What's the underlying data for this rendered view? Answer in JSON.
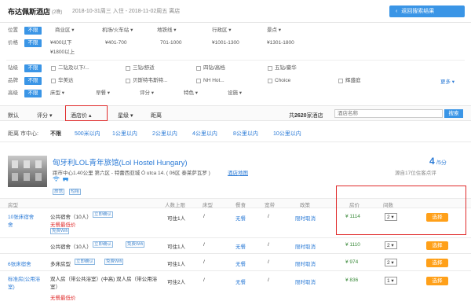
{
  "header": {
    "hotel": "布达佩斯酒店",
    "nights": "(2晚)",
    "dates": "2018-10-31周三 入住 - 2018-11-02周五 离店",
    "back_button": "返回搜索结果"
  },
  "filters": {
    "location_label": "位置",
    "location_opts": [
      "不限",
      "商业区",
      "机场/火车站",
      "地铁线",
      "行政区",
      "景点"
    ],
    "price_label": "价格",
    "price_opts": [
      "不限",
      "¥400以下",
      "¥401-700",
      "701-1000",
      "¥1001-1300",
      "¥1301-1800",
      "¥1800以上"
    ],
    "star_label": "钻级",
    "star_opts": [
      "不限",
      "二钻及以下/...",
      "三钻/舒适",
      "四钻/高档",
      "五钻/豪华"
    ],
    "brand_label": "品牌",
    "brand_opts": [
      "不限",
      "华美达",
      "贝斯特韦斯特...",
      "NH Hot...",
      "Choice",
      "辉盛庭"
    ],
    "more": "更多",
    "adv_label": "高级",
    "adv_opts": [
      "不限",
      "床型",
      "早餐",
      "评分",
      "特色",
      "设施"
    ]
  },
  "sortbar": {
    "default": "默认",
    "score": "评分",
    "price": "酒店价",
    "star": "星级",
    "distance": "距离",
    "count_prefix": "共",
    "count": "2620",
    "count_suffix": "家酒店",
    "search_placeholder": "酒店名称",
    "search_button": "搜索"
  },
  "distbar": {
    "label": "距离 市中心:",
    "opts": [
      "不限",
      "500米以内",
      "1公里以内",
      "2公里以内",
      "4公里以内",
      "8公里以内",
      "10公里以内"
    ]
  },
  "hotel": {
    "name": "匈牙利LOL青年旅馆(Lol Hostel Hungary)",
    "address": "距市中心1.40公里  第六区 - 特蕾西亚城 Ó utca 14. ( 06区 泰莱萨瓦罗 )",
    "map_link": "酒店地图",
    "tag1": "旅馆",
    "tag2": "短租",
    "score": "4",
    "score_suffix": "/5分",
    "reviews": "源自17位住客点评"
  },
  "table": {
    "headers": [
      "房型",
      "人数上限",
      "床型",
      "餐食",
      "宽带",
      "政策",
      "房价",
      "间数"
    ],
    "rooms": [
      {
        "type": "10张床宿舍",
        "name": "公共宿舍（10人）",
        "confirm": "立即确认",
        "promo": "无餐最低价",
        "wifi": "免费Wifi",
        "capacity": "可住1人",
        "bed": "/",
        "meal": "无餐",
        "net": "/",
        "policy": "限时取消",
        "price": "¥ 1114",
        "qty": "2",
        "book": "选择"
      },
      {
        "type": "",
        "name": "公共宿舍（10人）",
        "confirm": "立即确认",
        "promo": "",
        "wifi": "免费Wifi",
        "capacity": "可住1人",
        "bed": "/",
        "meal": "无餐",
        "net": "/",
        "policy": "限时取消",
        "price": "¥ 1110",
        "qty": "2",
        "book": "选择"
      },
      {
        "type": "6张床宿舍",
        "name": "多床房型",
        "confirm": "立即确认",
        "promo": "",
        "wifi": "免费Wifi",
        "capacity": "可住1人",
        "bed": "/",
        "meal": "无餐",
        "net": "/",
        "policy": "限时取消",
        "price": "¥ 974",
        "qty": "2",
        "book": "选择"
      },
      {
        "type": "标准房(公用浴室)",
        "name": "双人房（带公共浴室）(中高) 双人房（带公用浴室）",
        "confirm": "",
        "promo": "无餐最低价",
        "wifi": "",
        "capacity": "可住2人",
        "bed": "/",
        "meal": "无餐",
        "net": "/",
        "policy": "限时取消",
        "price": "¥ 836",
        "qty": "1",
        "book": "选择"
      }
    ]
  },
  "colors": {
    "accent": "#3a95e6",
    "link": "#2a7ad6",
    "orange": "#ffa019",
    "highlight": "#e02b2b",
    "green": "#3a8a3a"
  }
}
